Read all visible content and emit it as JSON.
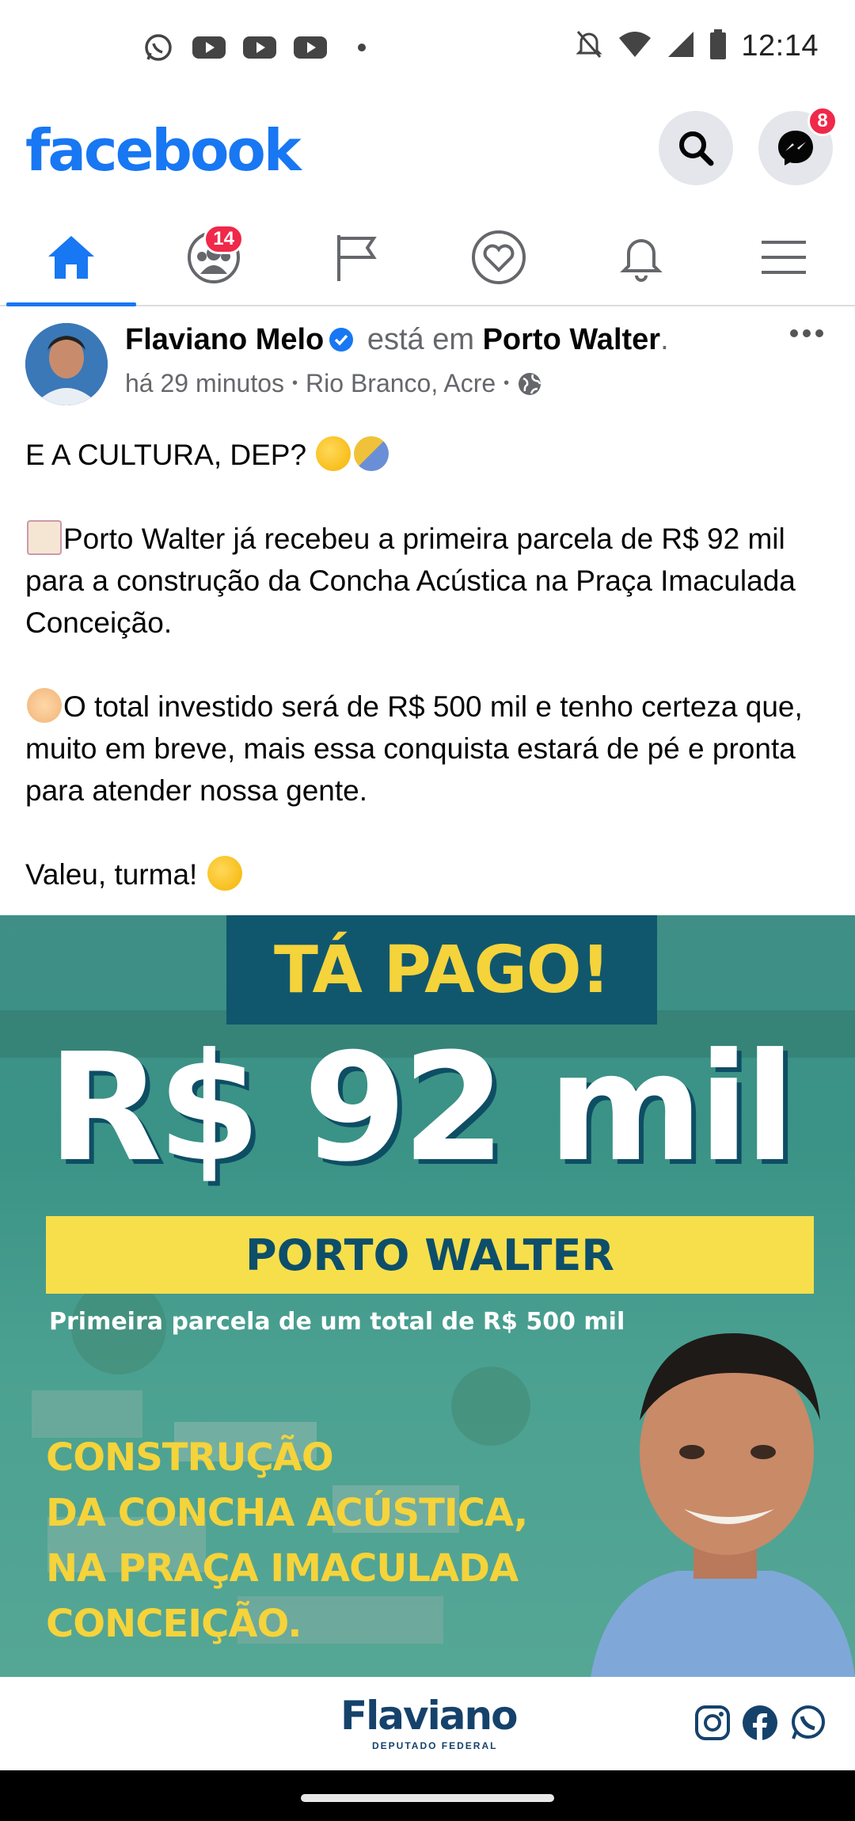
{
  "status_bar": {
    "time": "12:14",
    "left_icons": [
      "whatsapp-icon",
      "youtube-icon",
      "youtube-icon",
      "youtube-icon",
      "dot-icon"
    ],
    "right_icons": [
      "mute-icon",
      "wifi-icon",
      "signal-icon",
      "battery-icon"
    ]
  },
  "header": {
    "logo": "facebook",
    "messenger_badge": "8"
  },
  "tabs": [
    {
      "name": "home",
      "active": true
    },
    {
      "name": "groups",
      "badge": "14"
    },
    {
      "name": "pages"
    },
    {
      "name": "dating"
    },
    {
      "name": "notifications"
    },
    {
      "name": "menu"
    }
  ],
  "post": {
    "author": "Flaviano Melo",
    "connector": " está em ",
    "place": "Porto Walter",
    "period": ".",
    "time": "há 29 minutos",
    "location": "Rio Branco, Acre",
    "paragraphs": [
      "E A CULTURA, DEP?",
      "Porto Walter já recebeu a primeira parcela de R$ 92 mil para a construção da Concha Acústica na Praça Imaculada Conceição.",
      "O total investido será de R$ 500 mil e tenho certeza que, muito em breve, mais essa conquista estará de pé e pronta para atender nossa gente.",
      "Valeu, turma!"
    ]
  },
  "image": {
    "banner": "TÁ PAGO!",
    "amount": "R$ 92 mil",
    "city": "PORTO WALTER",
    "subline": "Primeira parcela de um total de R$ 500 mil",
    "construcao": [
      "CONSTRUÇÃO",
      "DA CONCHA ACÚSTICA,",
      "NA PRAÇA IMACULADA",
      "CONCEIÇÃO."
    ],
    "brand": "Flaviano",
    "brand_sub": "DEPUTADO FEDERAL",
    "colors": {
      "teal": "#3f8f86",
      "navy": "#10576e",
      "yellow": "#f5d33b"
    }
  },
  "colors": {
    "facebook_blue": "#1877f2",
    "badge_red": "#f02849"
  }
}
